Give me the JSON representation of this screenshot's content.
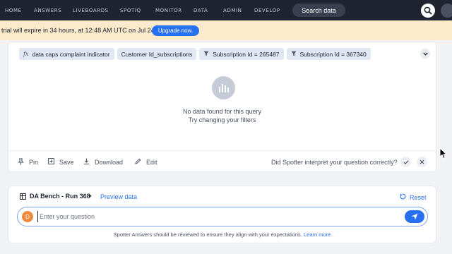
{
  "nav": {
    "items": [
      "HOME",
      "ANSWERS",
      "LIVEBOARDS",
      "SPOTIQ",
      "MONITOR",
      "DATA",
      "ADMIN",
      "DEVELOP"
    ],
    "search_label": "Search data",
    "search_icon": "search-icon"
  },
  "banner": {
    "text": "trial will expire in 34 hours, at 12:48 AM UTC on Jul 24.",
    "button": "Upgrade now."
  },
  "results": {
    "chips": [
      {
        "icon": "formula-icon",
        "label": "data caps complaint indicator"
      },
      {
        "icon": "",
        "label": "Customer Id_subscriptions"
      },
      {
        "icon": "filter-icon",
        "label": "Subscription Id = 265487"
      },
      {
        "icon": "filter-icon",
        "label": "Subscription Id = 367340"
      }
    ],
    "empty_title": "No data found for this query",
    "empty_subtitle": "Try changing your filters",
    "actions": {
      "pin": "Pin",
      "save": "Save",
      "download": "Download",
      "edit": "Edit"
    },
    "feedback_question": "Did Spotter interpret your question correctly?"
  },
  "question_panel": {
    "datasource": "DA Bench - Run 368",
    "preview_link": "Preview data",
    "reset": "Reset",
    "avatar_initial": "D",
    "placeholder": "Enter your question",
    "disclaimer": "Spotter Answers should be reviewed to ensure they align with your expectations.",
    "learn_more": "Learn more"
  },
  "colors": {
    "nav_bg": "#1f2430",
    "banner_bg": "#fbeacc",
    "accent": "#2770ef",
    "avatar": "#f08a3e"
  }
}
